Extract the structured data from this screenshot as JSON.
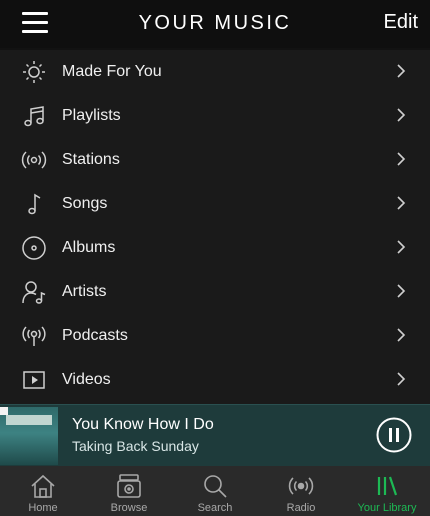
{
  "header": {
    "title": "YOUR MUSIC",
    "edit_label": "Edit"
  },
  "library": {
    "items": [
      {
        "label": "Made For You",
        "icon": "sun-icon"
      },
      {
        "label": "Playlists",
        "icon": "music-notes-icon"
      },
      {
        "label": "Stations",
        "icon": "radio-waves-icon"
      },
      {
        "label": "Songs",
        "icon": "music-note-icon"
      },
      {
        "label": "Albums",
        "icon": "album-disc-icon"
      },
      {
        "label": "Artists",
        "icon": "artist-icon"
      },
      {
        "label": "Podcasts",
        "icon": "podcast-icon"
      },
      {
        "label": "Videos",
        "icon": "video-play-icon"
      }
    ]
  },
  "now_playing": {
    "title": "You Know How I Do",
    "artist": "Taking Back Sunday"
  },
  "tabs": [
    {
      "label": "Home",
      "icon": "home-icon"
    },
    {
      "label": "Browse",
      "icon": "browse-icon"
    },
    {
      "label": "Search",
      "icon": "search-icon"
    },
    {
      "label": "Radio",
      "icon": "radio-icon"
    },
    {
      "label": "Your Library",
      "icon": "library-icon",
      "active": true
    }
  ],
  "colors": {
    "accent": "#1db954",
    "background": "#1a1a1a",
    "player": "#1e3b3b",
    "tabbar": "#2a2a2a"
  }
}
